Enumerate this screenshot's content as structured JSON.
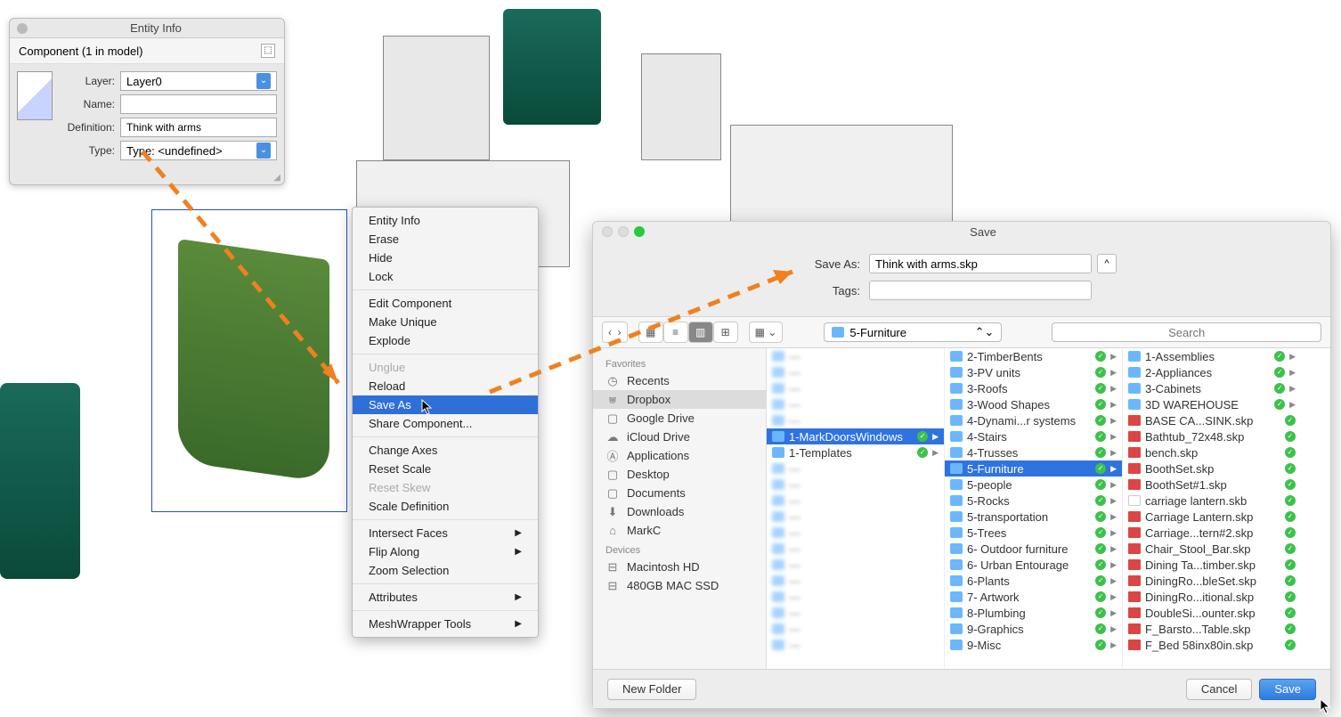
{
  "entity_info": {
    "title": "Entity Info",
    "subhead": "Component (1 in model)",
    "labels": {
      "layer": "Layer:",
      "name": "Name:",
      "definition": "Definition:",
      "type": "Type:"
    },
    "values": {
      "layer": "Layer0",
      "name": "",
      "definition": "Think with arms",
      "type": "Type: <undefined>"
    }
  },
  "context_menu": {
    "items": [
      {
        "label": "Entity Info"
      },
      {
        "label": "Erase"
      },
      {
        "label": "Hide"
      },
      {
        "label": "Lock"
      },
      {
        "sep": true
      },
      {
        "label": "Edit Component"
      },
      {
        "label": "Make Unique"
      },
      {
        "label": "Explode"
      },
      {
        "sep": true
      },
      {
        "label": "Unglue",
        "disabled": true
      },
      {
        "label": "Reload"
      },
      {
        "label": "Save As",
        "selected": true
      },
      {
        "label": "Share Component..."
      },
      {
        "sep": true
      },
      {
        "label": "Change Axes"
      },
      {
        "label": "Reset Scale"
      },
      {
        "label": "Reset Skew",
        "disabled": true
      },
      {
        "label": "Scale Definition"
      },
      {
        "sep": true
      },
      {
        "label": "Intersect Faces",
        "submenu": true
      },
      {
        "label": "Flip Along",
        "submenu": true
      },
      {
        "label": "Zoom Selection"
      },
      {
        "sep": true
      },
      {
        "label": "Attributes",
        "submenu": true
      },
      {
        "sep": true
      },
      {
        "label": "MeshWrapper Tools",
        "submenu": true
      }
    ]
  },
  "save_dialog": {
    "title": "Save",
    "save_as_label": "Save As:",
    "save_as_value": "Think with arms.skp",
    "tags_label": "Tags:",
    "tags_value": "",
    "path_current": "5-Furniture",
    "search_placeholder": "Search",
    "sidebar": {
      "favorites_head": "Favorites",
      "favorites": [
        {
          "icon": "clock",
          "label": "Recents"
        },
        {
          "icon": "dropbox",
          "label": "Dropbox",
          "selected": true
        },
        {
          "icon": "folder",
          "label": "Google Drive"
        },
        {
          "icon": "cloud",
          "label": "iCloud Drive"
        },
        {
          "icon": "app",
          "label": "Applications"
        },
        {
          "icon": "folder",
          "label": "Desktop"
        },
        {
          "icon": "folder",
          "label": "Documents"
        },
        {
          "icon": "download",
          "label": "Downloads"
        },
        {
          "icon": "home",
          "label": "MarkC"
        }
      ],
      "devices_head": "Devices",
      "devices": [
        {
          "icon": "disk",
          "label": "Macintosh HD"
        },
        {
          "icon": "disk",
          "label": "480GB MAC SSD"
        }
      ]
    },
    "col1": [
      {
        "t": "folder",
        "dim": true
      },
      {
        "t": "folder",
        "dim": true
      },
      {
        "t": "folder",
        "dim": true
      },
      {
        "t": "folder",
        "dim": true
      },
      {
        "t": "folder",
        "dim": true
      },
      {
        "t": "folder",
        "label": "1-MarkDoorsWindows",
        "sel": true,
        "check": true,
        "arrow": true
      },
      {
        "t": "folder",
        "label": "1-Templates",
        "check": true,
        "arrow": true
      },
      {
        "t": "folder",
        "dim": true
      },
      {
        "t": "folder",
        "dim": true
      },
      {
        "t": "folder",
        "dim": true
      },
      {
        "t": "folder",
        "dim": true
      },
      {
        "t": "folder",
        "dim": true
      },
      {
        "t": "folder",
        "dim": true
      },
      {
        "t": "folder",
        "dim": true
      },
      {
        "t": "folder",
        "dim": true
      },
      {
        "t": "folder",
        "dim": true
      },
      {
        "t": "folder",
        "dim": true
      },
      {
        "t": "folder",
        "dim": true
      },
      {
        "t": "folder",
        "dim": true
      }
    ],
    "col2": [
      {
        "t": "folder",
        "label": "2-TimberBents",
        "check": true,
        "arrow": true
      },
      {
        "t": "folder",
        "label": "3-PV units",
        "check": true,
        "arrow": true
      },
      {
        "t": "folder",
        "label": "3-Roofs",
        "check": true,
        "arrow": true
      },
      {
        "t": "folder",
        "label": "3-Wood Shapes",
        "check": true,
        "arrow": true
      },
      {
        "t": "folder",
        "label": "4-Dynami...r systems",
        "check": true,
        "arrow": true
      },
      {
        "t": "folder",
        "label": "4-Stairs",
        "check": true,
        "arrow": true
      },
      {
        "t": "folder",
        "label": "4-Trusses",
        "check": true,
        "arrow": true
      },
      {
        "t": "folder",
        "label": "5-Furniture",
        "sel": true,
        "check": true,
        "arrow": true
      },
      {
        "t": "folder",
        "label": "5-people",
        "check": true,
        "arrow": true
      },
      {
        "t": "folder",
        "label": "5-Rocks",
        "check": true,
        "arrow": true
      },
      {
        "t": "folder",
        "label": "5-transportation",
        "check": true,
        "arrow": true
      },
      {
        "t": "folder",
        "label": "5-Trees",
        "check": true,
        "arrow": true
      },
      {
        "t": "folder",
        "label": "6- Outdoor furniture",
        "check": true,
        "arrow": true
      },
      {
        "t": "folder",
        "label": "6- Urban Entourage",
        "check": true,
        "arrow": true
      },
      {
        "t": "folder",
        "label": "6-Plants",
        "check": true,
        "arrow": true
      },
      {
        "t": "folder",
        "label": "7- Artwork",
        "check": true,
        "arrow": true
      },
      {
        "t": "folder",
        "label": "8-Plumbing",
        "check": true,
        "arrow": true
      },
      {
        "t": "folder",
        "label": "9-Graphics",
        "check": true,
        "arrow": true
      },
      {
        "t": "folder",
        "label": "9-Misc",
        "check": true,
        "arrow": true
      }
    ],
    "col3": [
      {
        "t": "folder",
        "label": "1-Assemblies",
        "check": true,
        "arrow": true
      },
      {
        "t": "folder",
        "label": "2-Appliances",
        "check": true,
        "arrow": true
      },
      {
        "t": "folder",
        "label": "3-Cabinets",
        "check": true,
        "arrow": true
      },
      {
        "t": "folder",
        "label": "3D WAREHOUSE",
        "check": true,
        "arrow": true
      },
      {
        "t": "skp",
        "label": "BASE CA...SINK.skp",
        "check": true
      },
      {
        "t": "skp",
        "label": "Bathtub_72x48.skp",
        "check": true
      },
      {
        "t": "skp",
        "label": "bench.skp",
        "check": true
      },
      {
        "t": "skp",
        "label": "BoothSet.skp",
        "check": true
      },
      {
        "t": "skp",
        "label": "BoothSet#1.skp",
        "check": true
      },
      {
        "t": "blank",
        "label": "carriage lantern.skb",
        "check": true
      },
      {
        "t": "skp",
        "label": "Carriage Lantern.skp",
        "check": true
      },
      {
        "t": "skp",
        "label": "Carriage...tern#2.skp",
        "check": true
      },
      {
        "t": "skp",
        "label": "Chair_Stool_Bar.skp",
        "check": true
      },
      {
        "t": "skp",
        "label": "Dining Ta...timber.skp",
        "check": true
      },
      {
        "t": "skp",
        "label": "DiningRo...bleSet.skp",
        "check": true
      },
      {
        "t": "skp",
        "label": "DiningRo...itional.skp",
        "check": true
      },
      {
        "t": "skp",
        "label": "DoubleSi...ounter.skp",
        "check": true
      },
      {
        "t": "skp",
        "label": "F_Barsto...Table.skp",
        "check": true
      },
      {
        "t": "skp",
        "label": "F_Bed 58inx80in.skp",
        "check": true
      }
    ],
    "footer": {
      "new_folder": "New Folder",
      "cancel": "Cancel",
      "save": "Save"
    }
  }
}
